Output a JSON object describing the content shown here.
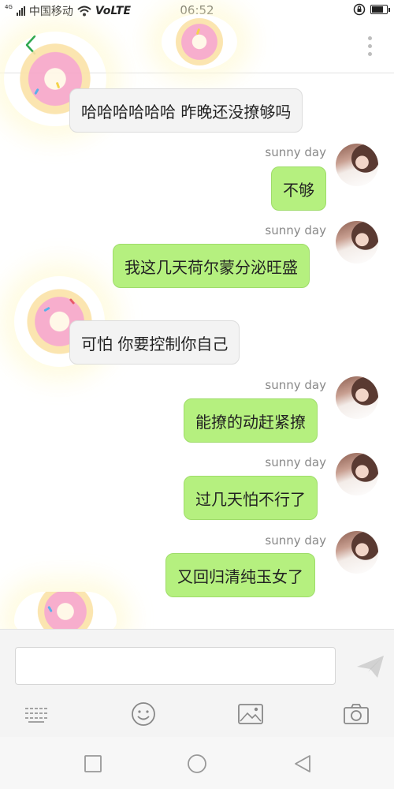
{
  "status_bar": {
    "signal_tag": "4G",
    "carrier": "中国移动",
    "network": "VoLTE",
    "time": "06:52",
    "battery_level": 0.7
  },
  "header": {
    "back_icon": "chevron-left-icon",
    "menu_icon": "more-vertical-icon",
    "accent_color": "#2fa84f"
  },
  "messages": [
    {
      "side": "in",
      "text": "哈哈哈哈哈哈 昨晚还没撩够吗"
    },
    {
      "side": "out",
      "sender": "sunny day",
      "text": "不够"
    },
    {
      "side": "out",
      "sender": "sunny day",
      "text": "我这几天荷尔蒙分泌旺盛"
    },
    {
      "side": "in",
      "text": "可怕 你要控制你自己"
    },
    {
      "side": "out",
      "sender": "sunny day",
      "text": "能撩的动赶紧撩"
    },
    {
      "side": "out",
      "sender": "sunny day",
      "text": "过几天怕不行了"
    },
    {
      "side": "out",
      "sender": "sunny day",
      "text": "又回归清纯玉女了"
    }
  ],
  "colors": {
    "outgoing_bubble": "#b5f07f",
    "incoming_bubble": "#f3f3f3"
  },
  "input": {
    "placeholder": "",
    "value": ""
  },
  "toolbar": {
    "icons": [
      "keyboard-icon",
      "emoji-icon",
      "image-icon",
      "camera-icon"
    ],
    "send_icon": "send-icon"
  },
  "navigation": {
    "icons": [
      "recent-apps-icon",
      "home-icon",
      "back-icon"
    ]
  }
}
